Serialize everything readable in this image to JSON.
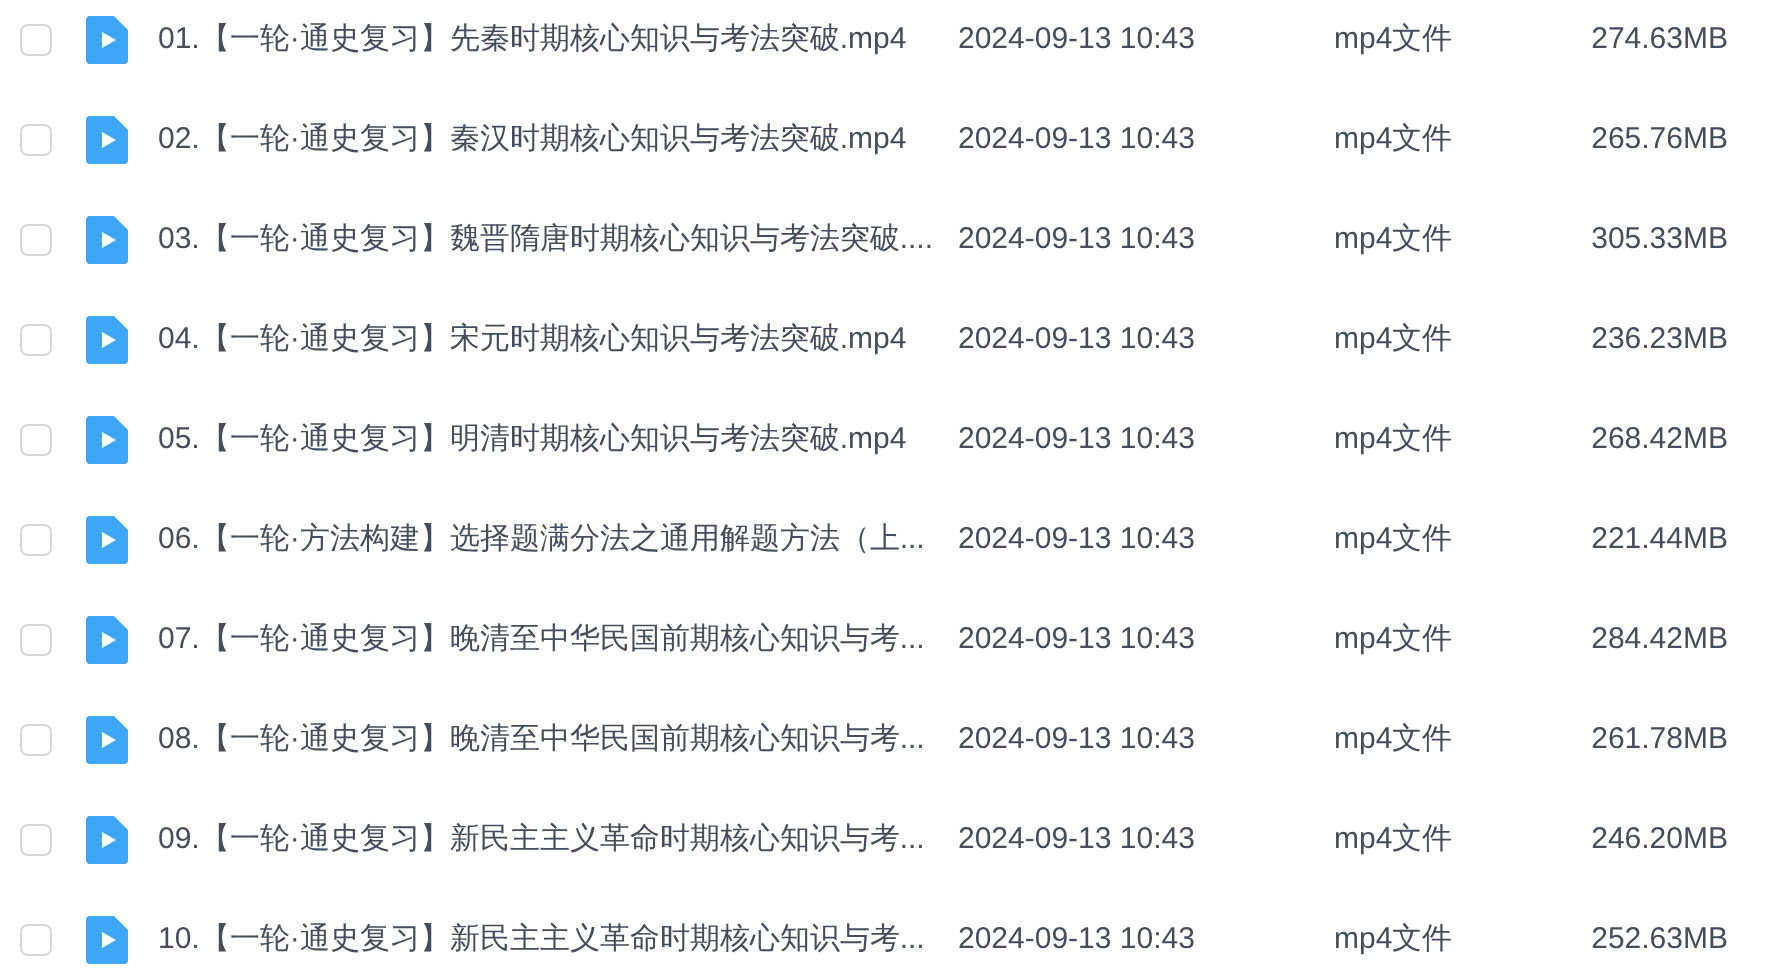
{
  "files": [
    {
      "checked": false,
      "name": "01.【一轮·通史复习】先秦时期核心知识与考法突破.mp4",
      "modified": "2024-09-13 10:43",
      "type": "mp4文件",
      "size": "274.63MB"
    },
    {
      "checked": false,
      "name": "02.【一轮·通史复习】秦汉时期核心知识与考法突破.mp4",
      "modified": "2024-09-13 10:43",
      "type": "mp4文件",
      "size": "265.76MB"
    },
    {
      "checked": false,
      "name": "03.【一轮·通史复习】魏晋隋唐时期核心知识与考法突破....",
      "modified": "2024-09-13 10:43",
      "type": "mp4文件",
      "size": "305.33MB"
    },
    {
      "checked": false,
      "name": "04.【一轮·通史复习】宋元时期核心知识与考法突破.mp4",
      "modified": "2024-09-13 10:43",
      "type": "mp4文件",
      "size": "236.23MB"
    },
    {
      "checked": false,
      "name": "05.【一轮·通史复习】明清时期核心知识与考法突破.mp4",
      "modified": "2024-09-13 10:43",
      "type": "mp4文件",
      "size": "268.42MB"
    },
    {
      "checked": false,
      "name": "06.【一轮·方法构建】选择题满分法之通用解题方法（上...",
      "modified": "2024-09-13 10:43",
      "type": "mp4文件",
      "size": "221.44MB"
    },
    {
      "checked": false,
      "name": "07.【一轮·通史复习】晚清至中华民国前期核心知识与考...",
      "modified": "2024-09-13 10:43",
      "type": "mp4文件",
      "size": "284.42MB"
    },
    {
      "checked": false,
      "name": "08.【一轮·通史复习】晚清至中华民国前期核心知识与考...",
      "modified": "2024-09-13 10:43",
      "type": "mp4文件",
      "size": "261.78MB"
    },
    {
      "checked": false,
      "name": "09.【一轮·通史复习】新民主主义革命时期核心知识与考...",
      "modified": "2024-09-13 10:43",
      "type": "mp4文件",
      "size": "246.20MB"
    },
    {
      "checked": false,
      "name": "10.【一轮·通史复习】新民主主义革命时期核心知识与考...",
      "modified": "2024-09-13 10:43",
      "type": "mp4文件",
      "size": "252.63MB"
    }
  ]
}
